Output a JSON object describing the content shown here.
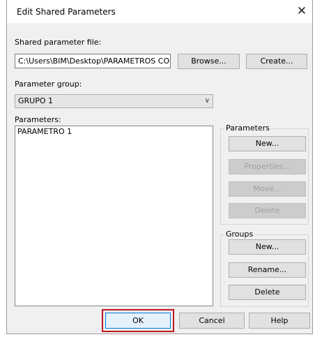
{
  "window": {
    "title": "Edit Shared Parameters",
    "close_glyph": "✕"
  },
  "shared_file": {
    "label": "Shared parameter file:",
    "path": "C:\\Users\\BIM\\Desktop\\PARAMETROS CO",
    "browse_label": "Browse...",
    "create_label": "Create..."
  },
  "parameter_group": {
    "label": "Parameter group:",
    "selected": "GRUPO 1",
    "arrow": "∨"
  },
  "parameters": {
    "label": "Parameters:",
    "items": [
      "PARAMETRO 1"
    ]
  },
  "parameters_box": {
    "legend": "Parameters",
    "new_label": "New...",
    "properties_label": "Properties...",
    "move_label": "Move...",
    "delete_label": "Delete"
  },
  "groups_box": {
    "legend": "Groups",
    "new_label": "New...",
    "rename_label": "Rename...",
    "delete_label": "Delete"
  },
  "footer": {
    "ok_label": "OK",
    "cancel_label": "Cancel",
    "help_label": "Help"
  },
  "colors": {
    "highlight": "#c0181e",
    "ok_border": "#0078d7"
  }
}
